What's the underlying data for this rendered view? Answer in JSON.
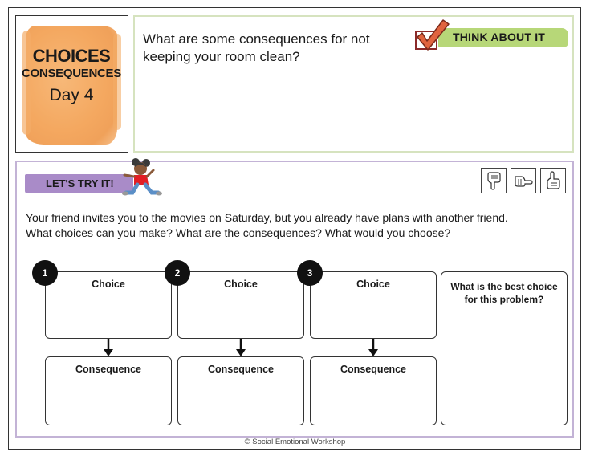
{
  "title_card": {
    "line1": "CHOICES",
    "line2": "CONSEQUENCES",
    "line3": "Day 4",
    "background_color": "#f4a860"
  },
  "think_about_it": {
    "banner_label": "THINK ABOUT IT",
    "banner_color": "#b7d778",
    "icon": "checkmark-box-icon",
    "question": "What are some consequences for not keeping your room clean?"
  },
  "lets_try_it": {
    "banner_label": "LET'S TRY IT!",
    "banner_color": "#a98bc8",
    "mascot_icon": "running-girl-icon",
    "rating_icons": [
      "thumbs-down-icon",
      "thumbs-sideways-icon",
      "thumbs-up-icon"
    ],
    "prompt_line1": "Your friend invites you to the movies on Saturday, but you already have plans with another friend.",
    "prompt_line2": "What choices can you make? What are the consequences? What would you choose?",
    "options": [
      {
        "number": "1",
        "choice_label": "Choice",
        "consequence_label": "Consequence"
      },
      {
        "number": "2",
        "choice_label": "Choice",
        "consequence_label": "Consequence"
      },
      {
        "number": "3",
        "choice_label": "Choice",
        "consequence_label": "Consequence"
      }
    ],
    "best_choice_label": "What is the best choice for this problem?"
  },
  "footer": {
    "copyright": "© Social Emotional Workshop"
  }
}
